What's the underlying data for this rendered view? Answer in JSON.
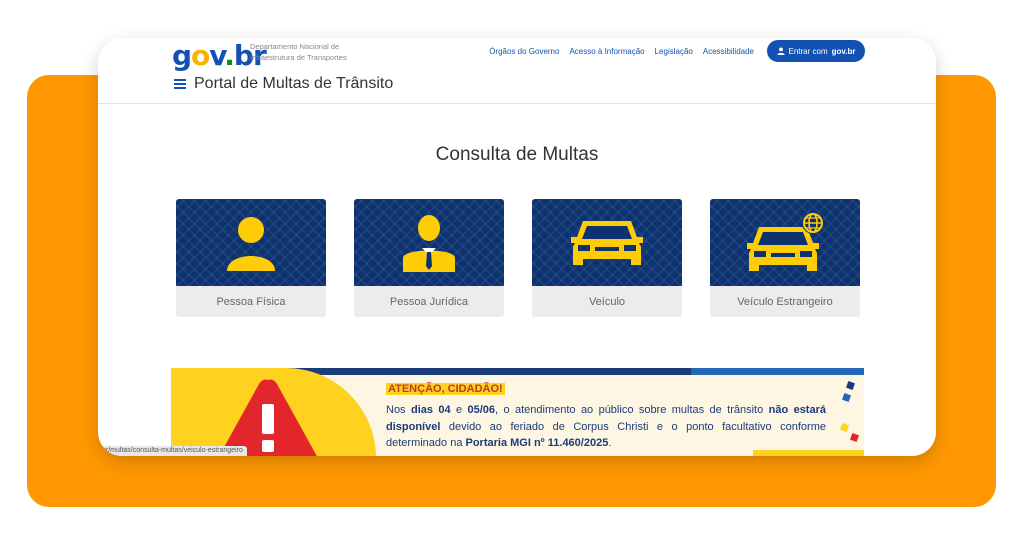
{
  "header": {
    "logo": {
      "g": "g",
      "o": "o",
      "v": "v",
      "dot": ".",
      "br": "br"
    },
    "department_line1": "Departamento Nacional de",
    "department_line2": "Infraestrutura de Transportes",
    "nav": [
      "Órgãos do Governo",
      "Acesso à Informação",
      "Legislação",
      "Acessibilidade"
    ],
    "login_prefix": "Entrar com",
    "login_brand": "gov.br",
    "portal_title": "Portal de Multas de Trânsito"
  },
  "main": {
    "title": "Consulta de Multas",
    "cards": [
      {
        "label": "Pessoa Física",
        "icon": "person-icon"
      },
      {
        "label": "Pessoa Jurídica",
        "icon": "business-person-icon"
      },
      {
        "label": "Veículo",
        "icon": "car-icon"
      },
      {
        "label": "Veículo Estrangeiro",
        "icon": "car-globe-icon"
      }
    ]
  },
  "banner": {
    "heading": "ATENÇÃO, CIDADÃO!",
    "p1": "Nos ",
    "p2": "dias 04",
    "p3": " e ",
    "p4": "05/06",
    "p5": ",  o atendimento ao público sobre multas de trânsito ",
    "p6": "não estará disponível",
    "p7": " devido ao feriado de Corpus Christi e o ponto facultativo conforme determinado na ",
    "p8": "Portaria MGI nº 11.460/2025",
    "p9": "."
  },
  "status_url": "br/multas/consulta-multas/veiculo-estrangeiro",
  "colors": {
    "accent_orange": "#ff9800",
    "gov_blue": "#1351b4",
    "card_navy": "#0c326f",
    "icon_yellow": "#ffcd07"
  }
}
